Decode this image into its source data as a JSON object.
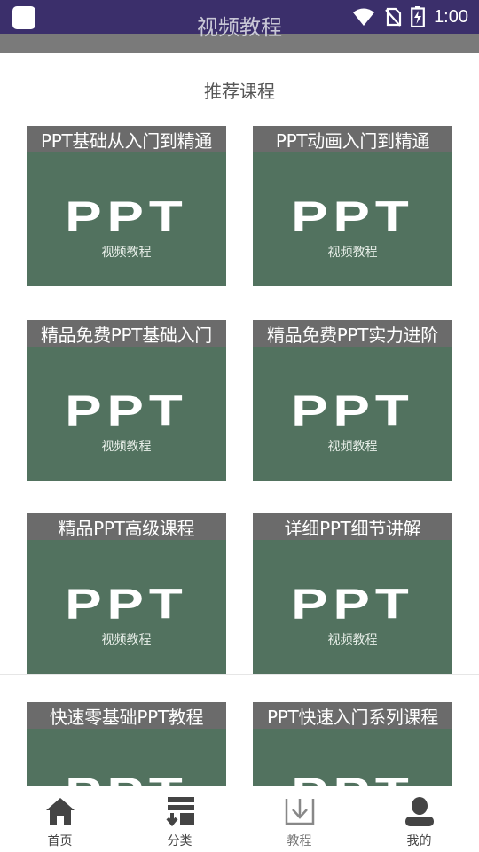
{
  "status_bar": {
    "time": "1:00",
    "icons": [
      "app-icon",
      "wifi-icon",
      "no-sim-icon",
      "battery-charging-icon"
    ]
  },
  "header": {
    "title": "视频教程"
  },
  "section": {
    "title": "推荐课程"
  },
  "courses": [
    {
      "title": "PPT基础从入门到精通",
      "logo": "PPT",
      "subtitle": "视频教程"
    },
    {
      "title": "PPT动画入门到精通",
      "logo": "PPT",
      "subtitle": "视频教程"
    },
    {
      "title": "精品免费PPT基础入门",
      "logo": "PPT",
      "subtitle": "视频教程"
    },
    {
      "title": "精品免费PPT实力进阶",
      "logo": "PPT",
      "subtitle": "视频教程"
    },
    {
      "title": "精品PPT高级课程",
      "logo": "PPT",
      "subtitle": "视频教程"
    },
    {
      "title": "详细PPT细节讲解",
      "logo": "PPT",
      "subtitle": "视频教程"
    },
    {
      "title": "快速零基础PPT教程",
      "logo": "PPT",
      "subtitle": ""
    },
    {
      "title": "PPT快速入门系列课程",
      "logo": "PPT",
      "subtitle": ""
    }
  ],
  "nav": {
    "items": [
      {
        "label": "首页",
        "icon": "home-icon"
      },
      {
        "label": "分类",
        "icon": "category-icon"
      },
      {
        "label": "教程",
        "icon": "download-arrow-icon"
      },
      {
        "label": "我的",
        "icon": "user-icon"
      }
    ]
  },
  "colors": {
    "status_bar": "#3b2f6b",
    "card_bg": "#52725f",
    "card_title_bg": "#6b6b6b",
    "icon_dark": "#444444",
    "icon_muted": "#888888"
  }
}
